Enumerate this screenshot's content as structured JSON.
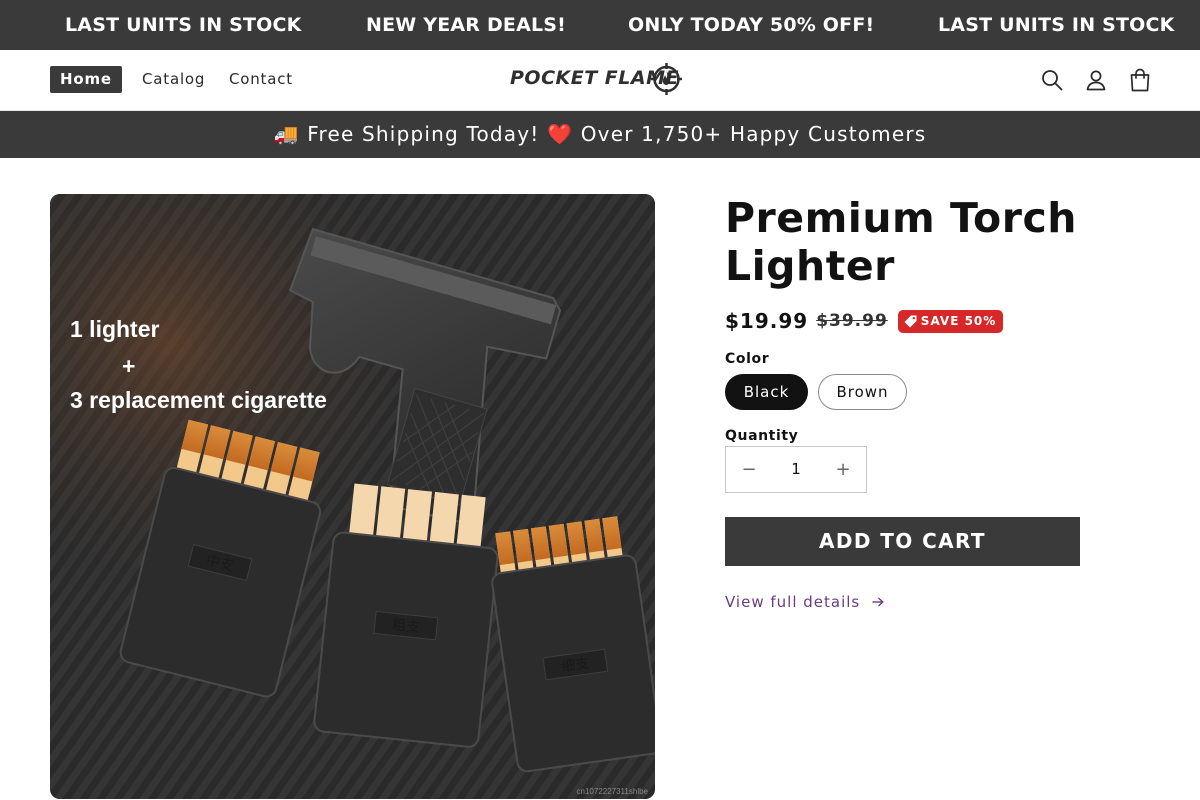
{
  "announcement": {
    "items": [
      "LAST UNITS IN STOCK",
      "NEW YEAR DEALS!",
      "ONLY TODAY 50% OFF!",
      "LAST UNITS IN STOCK"
    ]
  },
  "header": {
    "nav": [
      {
        "label": "Home",
        "active": true
      },
      {
        "label": "Catalog",
        "active": false
      },
      {
        "label": "Contact",
        "active": false
      }
    ],
    "logo_text": "POCKET FLAME",
    "icons": [
      "search-icon",
      "account-icon",
      "cart-icon"
    ]
  },
  "shipping_bar": {
    "text": "🚚 Free Shipping Today! ❤️ Over 1,750+ Happy Customers"
  },
  "product": {
    "title": "Premium Torch Lighter",
    "price": "$19.99",
    "compare_price": "$39.99",
    "badge": "SAVE 50%",
    "color_label": "Color",
    "colors": [
      {
        "label": "Black",
        "selected": true
      },
      {
        "label": "Brown",
        "selected": false
      }
    ],
    "quantity_label": "Quantity",
    "quantity_value": "1",
    "quantity_minus": "−",
    "quantity_plus": "+",
    "add_to_cart": "ADD TO CART",
    "details_link": "View full details",
    "image": {
      "caption_line1": "1 lighter",
      "caption_line2": "+",
      "caption_line3": "3 replacement cigarette",
      "case_labels": [
        "中支",
        "粗支",
        "细支"
      ],
      "watermark": "cn1072227311shlbe"
    }
  },
  "colors": {
    "dark_bar": "#3a3a3a",
    "sale_red": "#d62828",
    "link_purple": "#6a3c7c"
  }
}
